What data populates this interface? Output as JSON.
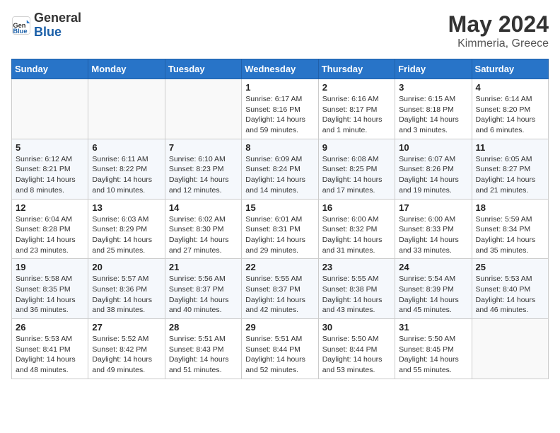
{
  "header": {
    "logo_general": "General",
    "logo_blue": "Blue",
    "month": "May 2024",
    "location": "Kimmeria, Greece"
  },
  "weekdays": [
    "Sunday",
    "Monday",
    "Tuesday",
    "Wednesday",
    "Thursday",
    "Friday",
    "Saturday"
  ],
  "weeks": [
    [
      {
        "day": "",
        "info": ""
      },
      {
        "day": "",
        "info": ""
      },
      {
        "day": "",
        "info": ""
      },
      {
        "day": "1",
        "info": "Sunrise: 6:17 AM\nSunset: 8:16 PM\nDaylight: 14 hours and 59 minutes."
      },
      {
        "day": "2",
        "info": "Sunrise: 6:16 AM\nSunset: 8:17 PM\nDaylight: 14 hours and 1 minute."
      },
      {
        "day": "3",
        "info": "Sunrise: 6:15 AM\nSunset: 8:18 PM\nDaylight: 14 hours and 3 minutes."
      },
      {
        "day": "4",
        "info": "Sunrise: 6:14 AM\nSunset: 8:20 PM\nDaylight: 14 hours and 6 minutes."
      }
    ],
    [
      {
        "day": "5",
        "info": "Sunrise: 6:12 AM\nSunset: 8:21 PM\nDaylight: 14 hours and 8 minutes."
      },
      {
        "day": "6",
        "info": "Sunrise: 6:11 AM\nSunset: 8:22 PM\nDaylight: 14 hours and 10 minutes."
      },
      {
        "day": "7",
        "info": "Sunrise: 6:10 AM\nSunset: 8:23 PM\nDaylight: 14 hours and 12 minutes."
      },
      {
        "day": "8",
        "info": "Sunrise: 6:09 AM\nSunset: 8:24 PM\nDaylight: 14 hours and 14 minutes."
      },
      {
        "day": "9",
        "info": "Sunrise: 6:08 AM\nSunset: 8:25 PM\nDaylight: 14 hours and 17 minutes."
      },
      {
        "day": "10",
        "info": "Sunrise: 6:07 AM\nSunset: 8:26 PM\nDaylight: 14 hours and 19 minutes."
      },
      {
        "day": "11",
        "info": "Sunrise: 6:05 AM\nSunset: 8:27 PM\nDaylight: 14 hours and 21 minutes."
      }
    ],
    [
      {
        "day": "12",
        "info": "Sunrise: 6:04 AM\nSunset: 8:28 PM\nDaylight: 14 hours and 23 minutes."
      },
      {
        "day": "13",
        "info": "Sunrise: 6:03 AM\nSunset: 8:29 PM\nDaylight: 14 hours and 25 minutes."
      },
      {
        "day": "14",
        "info": "Sunrise: 6:02 AM\nSunset: 8:30 PM\nDaylight: 14 hours and 27 minutes."
      },
      {
        "day": "15",
        "info": "Sunrise: 6:01 AM\nSunset: 8:31 PM\nDaylight: 14 hours and 29 minutes."
      },
      {
        "day": "16",
        "info": "Sunrise: 6:00 AM\nSunset: 8:32 PM\nDaylight: 14 hours and 31 minutes."
      },
      {
        "day": "17",
        "info": "Sunrise: 6:00 AM\nSunset: 8:33 PM\nDaylight: 14 hours and 33 minutes."
      },
      {
        "day": "18",
        "info": "Sunrise: 5:59 AM\nSunset: 8:34 PM\nDaylight: 14 hours and 35 minutes."
      }
    ],
    [
      {
        "day": "19",
        "info": "Sunrise: 5:58 AM\nSunset: 8:35 PM\nDaylight: 14 hours and 36 minutes."
      },
      {
        "day": "20",
        "info": "Sunrise: 5:57 AM\nSunset: 8:36 PM\nDaylight: 14 hours and 38 minutes."
      },
      {
        "day": "21",
        "info": "Sunrise: 5:56 AM\nSunset: 8:37 PM\nDaylight: 14 hours and 40 minutes."
      },
      {
        "day": "22",
        "info": "Sunrise: 5:55 AM\nSunset: 8:37 PM\nDaylight: 14 hours and 42 minutes."
      },
      {
        "day": "23",
        "info": "Sunrise: 5:55 AM\nSunset: 8:38 PM\nDaylight: 14 hours and 43 minutes."
      },
      {
        "day": "24",
        "info": "Sunrise: 5:54 AM\nSunset: 8:39 PM\nDaylight: 14 hours and 45 minutes."
      },
      {
        "day": "25",
        "info": "Sunrise: 5:53 AM\nSunset: 8:40 PM\nDaylight: 14 hours and 46 minutes."
      }
    ],
    [
      {
        "day": "26",
        "info": "Sunrise: 5:53 AM\nSunset: 8:41 PM\nDaylight: 14 hours and 48 minutes."
      },
      {
        "day": "27",
        "info": "Sunrise: 5:52 AM\nSunset: 8:42 PM\nDaylight: 14 hours and 49 minutes."
      },
      {
        "day": "28",
        "info": "Sunrise: 5:51 AM\nSunset: 8:43 PM\nDaylight: 14 hours and 51 minutes."
      },
      {
        "day": "29",
        "info": "Sunrise: 5:51 AM\nSunset: 8:44 PM\nDaylight: 14 hours and 52 minutes."
      },
      {
        "day": "30",
        "info": "Sunrise: 5:50 AM\nSunset: 8:44 PM\nDaylight: 14 hours and 53 minutes."
      },
      {
        "day": "31",
        "info": "Sunrise: 5:50 AM\nSunset: 8:45 PM\nDaylight: 14 hours and 55 minutes."
      },
      {
        "day": "",
        "info": ""
      }
    ]
  ]
}
